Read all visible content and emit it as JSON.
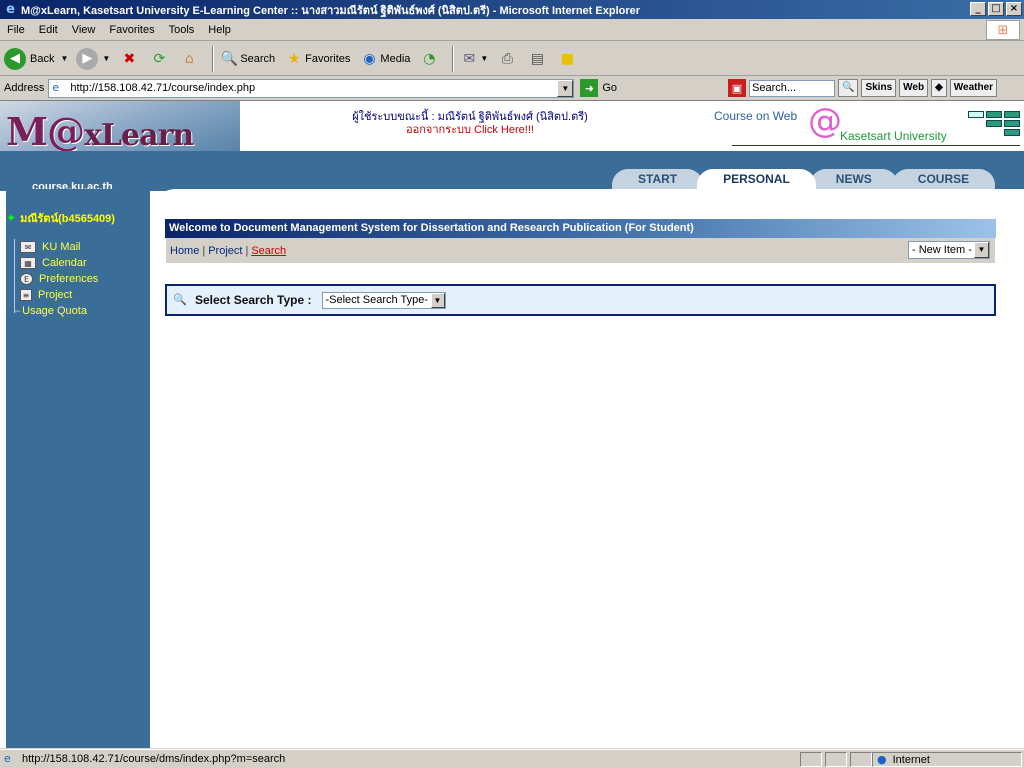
{
  "window": {
    "title": "M@xLearn, Kasetsart University E-Learning Center :: นางสาวมณีรัตน์ ฐิติพันธ์พงศ์ (นิสิตป.ตรี) - Microsoft Internet Explorer"
  },
  "menubar": {
    "items": [
      "File",
      "Edit",
      "View",
      "Favorites",
      "Tools",
      "Help"
    ]
  },
  "toolbar": {
    "back": "Back",
    "search": "Search",
    "favorites": "Favorites",
    "media": "Media"
  },
  "address": {
    "label": "Address",
    "url": "http://158.108.42.71/course/index.php",
    "go": "Go",
    "search_placeholder": "Search...",
    "skins": "Skins",
    "web": "Web",
    "weather": "Weather"
  },
  "header": {
    "logo_prefix": "M@",
    "logo_suffix": "xLearn",
    "domain": "course.ku.ac.th",
    "user_line": "ผู้ใช้ระบบขณะนี้ : มณีรัตน์ ฐิติพันธ์พงศ์ (นิสิตป.ตรี)",
    "logout_line": "ออกจากระบบ Click Here!!!",
    "course_on_web": "Course on Web",
    "at": "@",
    "university": "Kasetsart University"
  },
  "tabs": [
    "START",
    "PERSONAL",
    "NEWS",
    "COURSE"
  ],
  "sidebar": {
    "username": "มณีรัตน์(b4565409)",
    "items": [
      {
        "label": "KU Mail"
      },
      {
        "label": "Calendar"
      },
      {
        "label": "Preferences"
      },
      {
        "label": "Project"
      },
      {
        "label": "Usage Quota"
      }
    ]
  },
  "main": {
    "welcome": "Welcome to Document Management System for Dissertation and Research Publication (For Student)",
    "nav": [
      "Home",
      "Project",
      "Search"
    ],
    "new_item": "- New Item -",
    "search_label": "Select Search Type :",
    "search_select": "-Select Search Type-"
  },
  "status": {
    "url": "http://158.108.42.71/course/dms/index.php?m=search",
    "zone": "Internet"
  },
  "colors": {
    "accent": "#3a6e98",
    "title": "#0a246a",
    "link_active": "#cc0000",
    "sidebar_text": "#ffff40"
  }
}
